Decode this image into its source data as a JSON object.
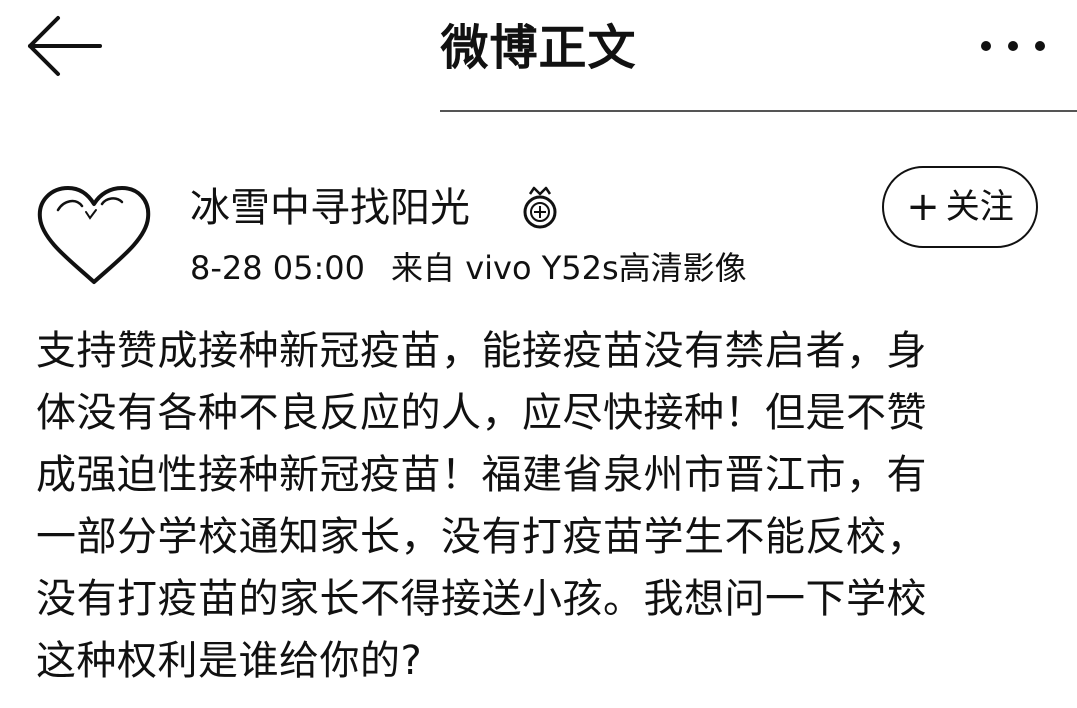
{
  "header": {
    "title": "微博正文",
    "back_icon": "arrow-left-icon",
    "more_icon": "more-dots-icon"
  },
  "author": {
    "name": "冰雪中寻找阳光",
    "badge_icon": "crown-badge-icon",
    "timestamp": "8-28 05:00",
    "source": "来自 vivo Y52s高清影像",
    "avatar_icon": "heart-avatar-icon",
    "follow_plus": "+",
    "follow_label": "关注"
  },
  "post": {
    "lines": [
      "支持赞成接种新冠疫苗，能接疫苗没有禁启者，身",
      "体没有各种不良反应的人，应尽快接种！但是不赞",
      "成强迫性接种新冠疫苗！福建省泉州市晋江市，有",
      "一部分学校通知家长，没有打疫苗学生不能反校，",
      "没有打疫苗的家长不得接送小孩。我想问一下学校",
      "这种权利是谁给你的?"
    ]
  }
}
